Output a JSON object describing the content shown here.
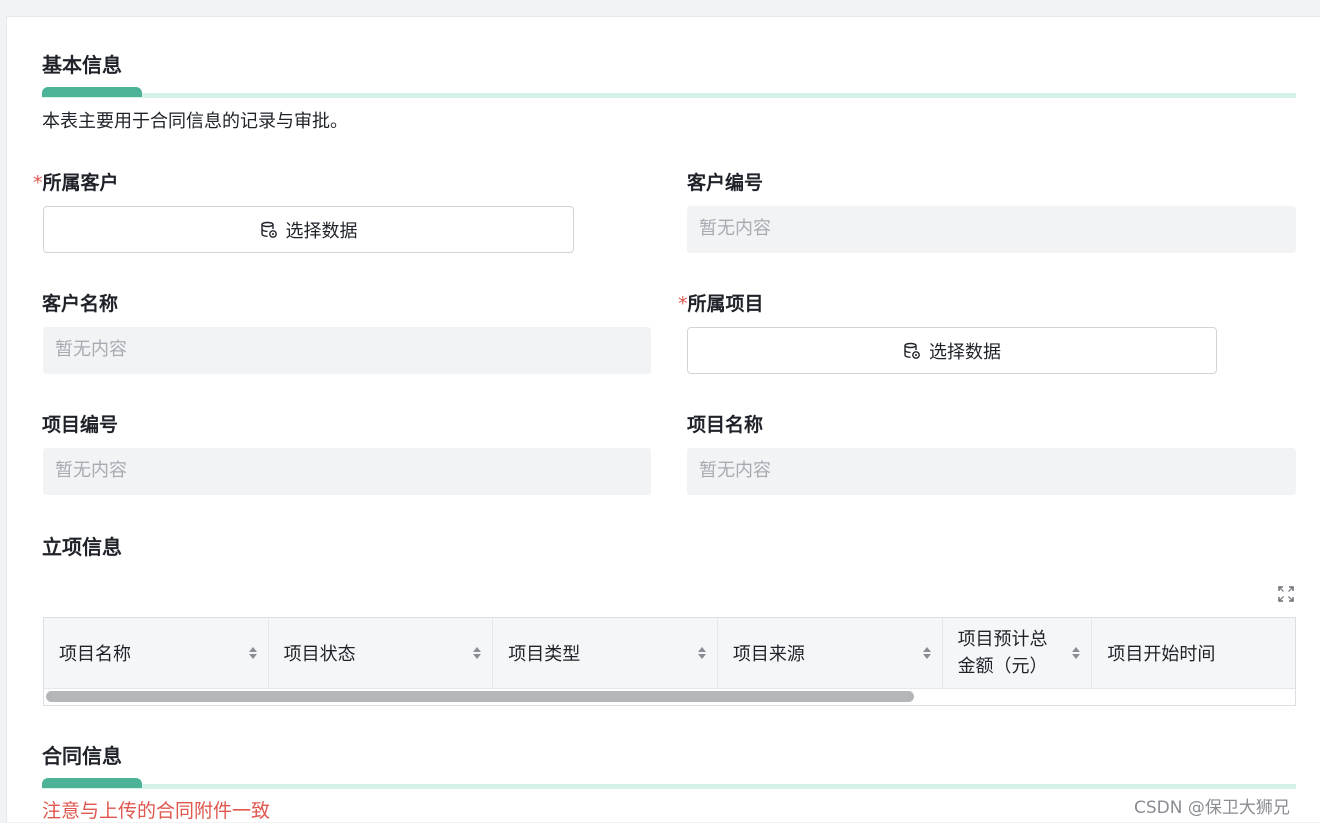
{
  "basic_info": {
    "title": "基本信息",
    "description": "本表主要用于合同信息的记录与审批。"
  },
  "required_mark": "*",
  "fields": {
    "customer": {
      "label": "所属客户",
      "button_label": "选择数据"
    },
    "customer_code": {
      "label": "客户编号",
      "value": "暂无内容"
    },
    "customer_name": {
      "label": "客户名称",
      "value": "暂无内容"
    },
    "project": {
      "label": "所属项目",
      "button_label": "选择数据"
    },
    "project_code": {
      "label": "项目编号",
      "value": "暂无内容"
    },
    "project_name": {
      "label": "项目名称",
      "value": "暂无内容"
    }
  },
  "project_setup": {
    "title": "立项信息",
    "columns": [
      {
        "label": "项目名称",
        "sortable": true
      },
      {
        "label": "项目状态",
        "sortable": true
      },
      {
        "label": "项目类型",
        "sortable": true
      },
      {
        "label": "项目来源",
        "sortable": true
      },
      {
        "label": "项目预计总金额（元）",
        "sortable": true
      },
      {
        "label": "项目开始时间",
        "sortable": false
      }
    ]
  },
  "contract_info": {
    "title": "合同信息",
    "notice": "注意与上传的合同附件一致"
  },
  "watermark": "CSDN @保卫大狮兄",
  "colors": {
    "accent": "#4db397",
    "accent_light": "#d6f1ea",
    "required": "#e0574f",
    "placeholder": "#a8abb2"
  }
}
